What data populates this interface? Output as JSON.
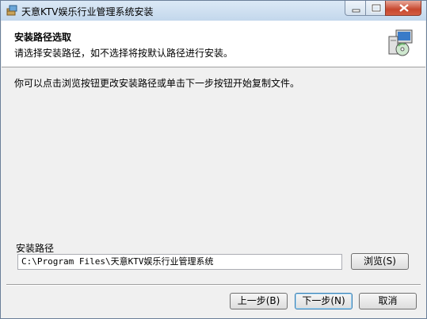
{
  "window": {
    "title": "天意KTV娱乐行业管理系统安装"
  },
  "header": {
    "title": "安装路径选取",
    "subtitle": "请选择安装路径，如不选择将按默认路径进行安装。"
  },
  "main": {
    "info_text": "你可以点击浏览按钮更改安装路径或单击下一步按钮开始复制文件。",
    "path_group_label": "安装路径",
    "path_value": "C:\\Program Files\\天意KTV娱乐行业管理系统",
    "browse_label": "浏览(S)"
  },
  "footer": {
    "back_label": "上一步(B)",
    "next_label": "下一步(N)",
    "cancel_label": "取消"
  },
  "icons": {
    "app": "installer-box-icon",
    "header": "setup-computer-cd-icon",
    "minimize": "minimize-icon",
    "maximize": "maximize-icon",
    "close": "close-icon"
  }
}
